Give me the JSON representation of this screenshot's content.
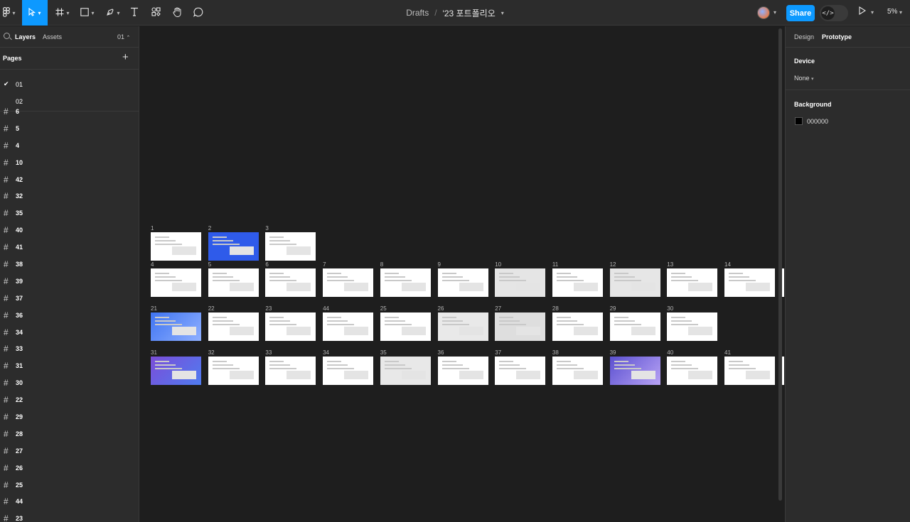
{
  "toolbar": {
    "breadcrumb_root": "Drafts",
    "breadcrumb_sep": "/",
    "file_name": "'23 포트폴리오",
    "share_label": "Share",
    "dev_mode_glyph": "</>",
    "zoom": "5%",
    "active_tool": "move"
  },
  "left_panel": {
    "tab_layers": "Layers",
    "tab_assets": "Assets",
    "current_page": "01",
    "pages_title": "Pages",
    "add_page": "+",
    "pages": [
      {
        "label": "01",
        "selected": true
      },
      {
        "label": "02",
        "selected": false
      }
    ],
    "layers": [
      "6",
      "5",
      "4",
      "10",
      "42",
      "32",
      "35",
      "40",
      "41",
      "38",
      "39",
      "37",
      "36",
      "34",
      "33",
      "31",
      "30",
      "22",
      "29",
      "28",
      "27",
      "26",
      "25",
      "44",
      "23"
    ]
  },
  "canvas": {
    "frames": [
      "1",
      "2",
      "3",
      "4",
      "5",
      "6",
      "7",
      "8",
      "9",
      "10",
      "11",
      "12",
      "13",
      "14",
      "21",
      "22",
      "23",
      "44",
      "25",
      "26",
      "27",
      "28",
      "29",
      "30",
      "31",
      "32",
      "33",
      "34",
      "35",
      "36",
      "37",
      "38",
      "39",
      "40",
      "41"
    ]
  },
  "right_panel": {
    "tab_design": "Design",
    "tab_prototype": "Prototype",
    "device_title": "Device",
    "device_value": "None",
    "background_title": "Background",
    "background_value": "000000"
  },
  "colors": {
    "accent": "#0d99ff",
    "panel": "#2c2c2c",
    "canvas": "#1e1e1e"
  }
}
